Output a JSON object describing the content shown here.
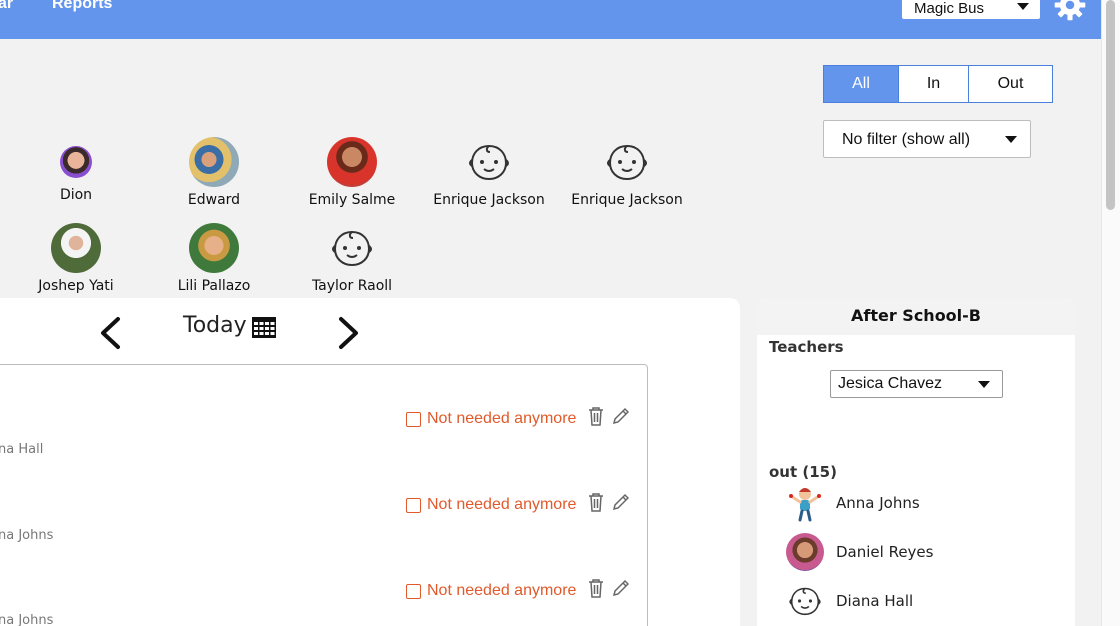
{
  "nav": {
    "items": [
      "ar",
      "Reports"
    ],
    "bus_select": "Magic Bus"
  },
  "filters": {
    "segments": [
      "All",
      "In",
      "Out"
    ],
    "active_segment": "All",
    "dropdown": "No filter (show all)"
  },
  "kids": [
    {
      "name": "Dion",
      "avatar": "photo"
    },
    {
      "name": "Edward",
      "avatar": "photo"
    },
    {
      "name": "Emily Salme",
      "avatar": "photo"
    },
    {
      "name": "Enrique Jackson",
      "avatar": "baby-icon"
    },
    {
      "name": "Enrique Jackson",
      "avatar": "baby-icon"
    },
    {
      "name": "Joshep Yati",
      "avatar": "photo"
    },
    {
      "name": "Lili Pallazo",
      "avatar": "photo"
    },
    {
      "name": "Taylor Raoll",
      "avatar": "baby-icon"
    }
  ],
  "calendar": {
    "today_label": "Today",
    "rows": [
      {
        "name": "na Hall",
        "action": "Not needed anymore"
      },
      {
        "name": "na Johns",
        "action": "Not needed anymore"
      },
      {
        "name": "na Johns",
        "action": "Not needed anymore"
      }
    ]
  },
  "side": {
    "title": "After School-B",
    "teachers_label": "Teachers",
    "teacher_selected": "Jesica Chavez",
    "out_label": "out (15)",
    "people": [
      {
        "name": "Anna Johns",
        "avatar": "cartoon"
      },
      {
        "name": "Daniel Reyes",
        "avatar": "photo"
      },
      {
        "name": "Diana Hall",
        "avatar": "baby-icon"
      }
    ]
  },
  "colors": {
    "nav_bg": "#6495ed",
    "accent_orange": "#e05a2b"
  }
}
